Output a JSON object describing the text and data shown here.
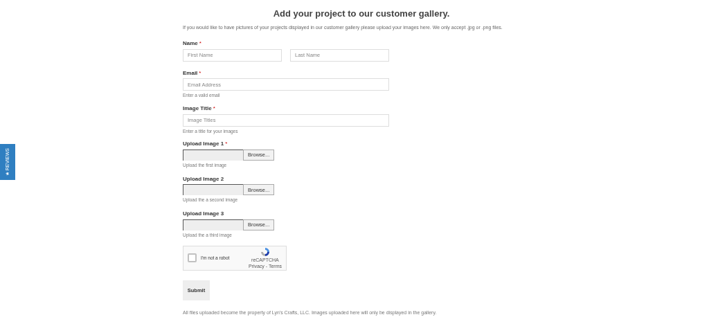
{
  "side_tab": {
    "icon": "★",
    "label": "REVIEWS"
  },
  "title": "Add your project to our customer gallery.",
  "intro": "If you would like to have pictures of your projects displayed in our customer gallery please upload your images here. We only accept .jpg or .png files.",
  "required_mark": "*",
  "fields": [
    {
      "kind": "name",
      "label": "Name",
      "required": true,
      "placeholders": [
        "First Name",
        "Last Name"
      ]
    },
    {
      "kind": "text",
      "label": "Email",
      "required": true,
      "placeholder": "Email Address",
      "hint": "Enter a valid email"
    },
    {
      "kind": "text",
      "label": "Image Title",
      "required": true,
      "placeholder": "Image Titles",
      "hint": "Enter a title for your images"
    },
    {
      "kind": "file",
      "label": "Upload Image 1",
      "required": true,
      "button": "Browse...",
      "hint": "Upload the first image"
    },
    {
      "kind": "file",
      "label": "Upload Image 2",
      "required": false,
      "button": "Browse...",
      "hint": "Upload the a second image"
    },
    {
      "kind": "file",
      "label": "Upload Image 3",
      "required": false,
      "button": "Browse...",
      "hint": "Upload the a third image"
    }
  ],
  "captcha": {
    "label": "I'm not a robot",
    "checked": false,
    "brand": "reCAPTCHA",
    "links": "Privacy - Terms"
  },
  "submit": "Submit",
  "footer_note": "All files uploaded become the property of Lyn's Crafts, LLC. Images uploaded here will only be displayed in the gallery."
}
